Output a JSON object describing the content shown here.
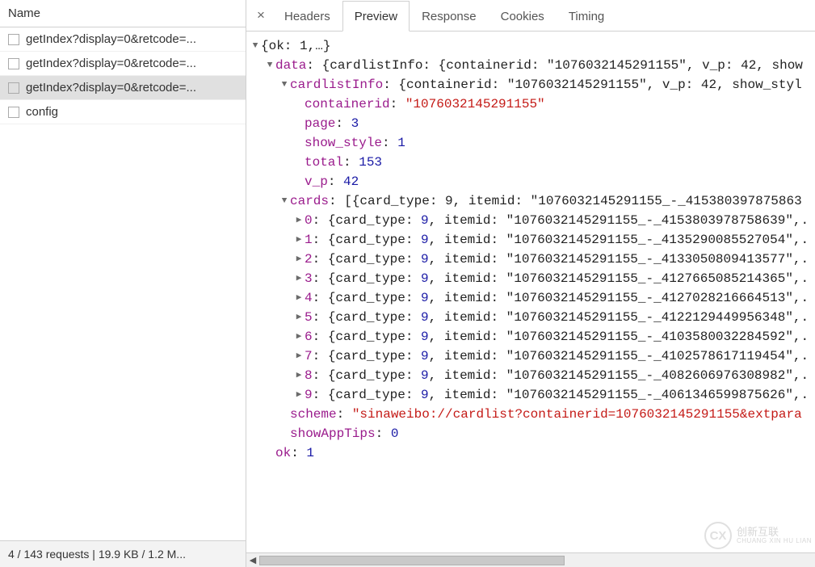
{
  "sidebar": {
    "header": "Name",
    "items": [
      {
        "label": "getIndex?display=0&retcode=...",
        "selected": false
      },
      {
        "label": "getIndex?display=0&retcode=...",
        "selected": false
      },
      {
        "label": "getIndex?display=0&retcode=...",
        "selected": true
      },
      {
        "label": "config",
        "selected": false
      }
    ],
    "footer": "4 / 143 requests  |  19.9 KB / 1.2 M..."
  },
  "tabs": {
    "close": "×",
    "items": [
      {
        "label": "Headers",
        "active": false
      },
      {
        "label": "Preview",
        "active": true
      },
      {
        "label": "Response",
        "active": false
      },
      {
        "label": "Cookies",
        "active": false
      },
      {
        "label": "Timing",
        "active": false
      }
    ]
  },
  "preview": {
    "root_summary": "{ok: 1,…}",
    "data_summary_prefix": "{cardlistInfo: {containerid: \"1076032145291155\", v_p: 42, show",
    "cardlist_summary_prefix": "{containerid: \"1076032145291155\", v_p: 42, show_styl",
    "cardlistInfo": {
      "containerid": "1076032145291155",
      "page": 3,
      "show_style": 1,
      "total": 153,
      "v_p": 42
    },
    "cards_summary_prefix": "[{card_type: 9, itemid: \"1076032145291155_-_415380397875863",
    "cards": [
      {
        "idx": 0,
        "card_type": 9,
        "itemid": "1076032145291155_-_4153803978758639"
      },
      {
        "idx": 1,
        "card_type": 9,
        "itemid": "1076032145291155_-_4135290085527054"
      },
      {
        "idx": 2,
        "card_type": 9,
        "itemid": "1076032145291155_-_4133050809413577"
      },
      {
        "idx": 3,
        "card_type": 9,
        "itemid": "1076032145291155_-_4127665085214365"
      },
      {
        "idx": 4,
        "card_type": 9,
        "itemid": "1076032145291155_-_4127028216664513"
      },
      {
        "idx": 5,
        "card_type": 9,
        "itemid": "1076032145291155_-_4122129449956348"
      },
      {
        "idx": 6,
        "card_type": 9,
        "itemid": "1076032145291155_-_4103580032284592"
      },
      {
        "idx": 7,
        "card_type": 9,
        "itemid": "1076032145291155_-_4102578617119454"
      },
      {
        "idx": 8,
        "card_type": 9,
        "itemid": "1076032145291155_-_4082606976308982"
      },
      {
        "idx": 9,
        "card_type": 9,
        "itemid": "1076032145291155_-_4061346599875626"
      }
    ],
    "scheme_prefix": "sinaweibo://cardlist?containerid=1076032145291155&extpara",
    "showAppTips": 0,
    "ok": 1,
    "labels": {
      "data": "data",
      "cardlistInfo": "cardlistInfo",
      "containerid": "containerid",
      "page": "page",
      "show_style": "show_style",
      "total": "total",
      "v_p": "v_p",
      "cards": "cards",
      "scheme": "scheme",
      "showAppTips": "showAppTips",
      "ok": "ok",
      "card_type": "card_type",
      "itemid": "itemid"
    }
  },
  "watermark": {
    "logo": "CX",
    "line1": "创新互联",
    "line2": "CHUANG XIN HU LIAN"
  }
}
